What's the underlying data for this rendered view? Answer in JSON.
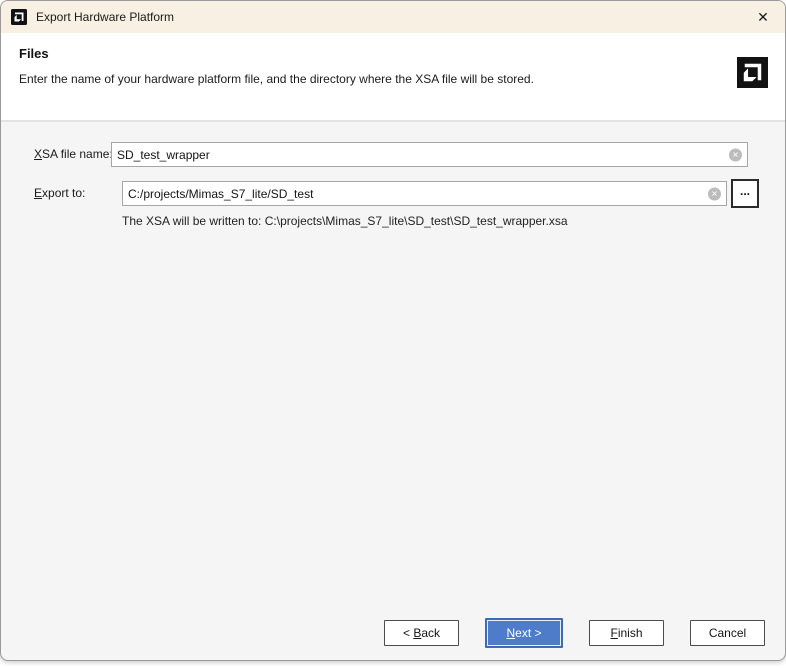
{
  "window": {
    "title": "Export Hardware Platform"
  },
  "icons": {
    "close": "✕",
    "clear": "✕",
    "browse": "...",
    "logo": "amd-logo"
  },
  "header": {
    "title": "Files",
    "description": "Enter the name of your hardware platform file, and the directory where the XSA file will be stored."
  },
  "fields": {
    "xsa_name": {
      "label_key": "X",
      "label_rest": "SA file name:",
      "value": "SD_test_wrapper"
    },
    "export_to": {
      "label_key": "E",
      "label_rest": "xport to:",
      "value": "C:/projects/Mimas_S7_lite/SD_test"
    }
  },
  "info": {
    "text": "The XSA will be written to: C:\\projects\\Mimas_S7_lite\\SD_test\\SD_test_wrapper.xsa"
  },
  "buttons": {
    "back": {
      "pre": "< ",
      "key": "B",
      "rest": "ack"
    },
    "next": {
      "key": "N",
      "rest": "ext >"
    },
    "finish": {
      "key": "F",
      "rest": "inish"
    },
    "cancel": {
      "label": "Cancel"
    }
  },
  "colors": {
    "accent_blue": "#4f7cc9",
    "titlebar_bg": "#f8f0e2",
    "content_bg": "#f5f5f5"
  }
}
